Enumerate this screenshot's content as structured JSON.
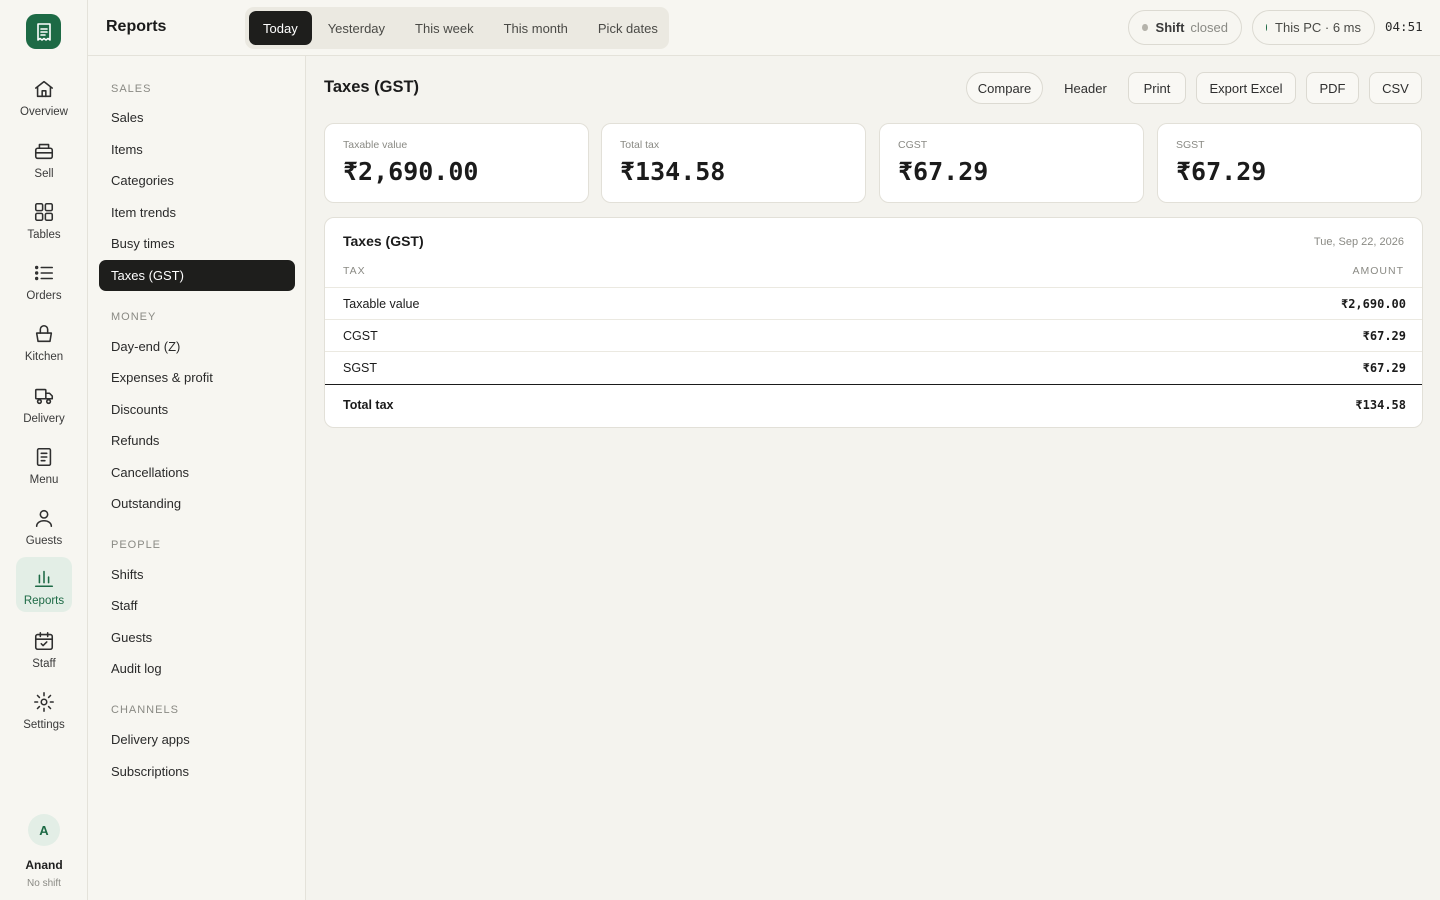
{
  "rail": {
    "items": [
      {
        "label": "Overview",
        "icon": "home-icon"
      },
      {
        "label": "Sell",
        "icon": "register-icon"
      },
      {
        "label": "Tables",
        "icon": "grid-icon"
      },
      {
        "label": "Orders",
        "icon": "list-icon"
      },
      {
        "label": "Kitchen",
        "icon": "basket-icon"
      },
      {
        "label": "Delivery",
        "icon": "truck-icon"
      },
      {
        "label": "Menu",
        "icon": "menu-book-icon"
      },
      {
        "label": "Guests",
        "icon": "person-icon"
      },
      {
        "label": "Reports",
        "icon": "bar-chart-icon",
        "active": true
      },
      {
        "label": "Staff",
        "icon": "calendar-icon"
      },
      {
        "label": "Settings",
        "icon": "sun-gear-icon"
      }
    ],
    "user": {
      "initial": "A",
      "name": "Anand",
      "status": "No shift"
    }
  },
  "topbar": {
    "title": "Reports",
    "ranges": [
      "Today",
      "Yesterday",
      "This week",
      "This month",
      "Pick dates"
    ],
    "active_range": "Today",
    "shift_label": "Shift",
    "shift_status": "closed",
    "device": "This PC · 6 ms",
    "clock": "04:51"
  },
  "colors": {
    "accent": "#1d6a45",
    "active_dark": "#1e1e1c",
    "status_closed": "#b5b3ab",
    "status_online": "#1d6a45"
  },
  "subnav": {
    "sections": [
      {
        "title": "SALES",
        "items": [
          "Sales",
          "Items",
          "Categories",
          "Item trends",
          "Busy times",
          "Taxes (GST)"
        ]
      },
      {
        "title": "MONEY",
        "items": [
          "Day-end (Z)",
          "Expenses & profit",
          "Discounts",
          "Refunds",
          "Cancellations",
          "Outstanding"
        ]
      },
      {
        "title": "PEOPLE",
        "items": [
          "Shifts",
          "Staff",
          "Guests",
          "Audit log"
        ]
      },
      {
        "title": "CHANNELS",
        "items": [
          "Delivery apps",
          "Subscriptions"
        ]
      }
    ],
    "active": "Taxes (GST)"
  },
  "main": {
    "title": "Taxes (GST)",
    "actions": {
      "compare": "Compare",
      "header": "Header",
      "print": "Print",
      "excel": "Export Excel",
      "pdf": "PDF",
      "csv": "CSV"
    },
    "cards": [
      {
        "label": "Taxable value",
        "value": "₹2,690.00"
      },
      {
        "label": "Total tax",
        "value": "₹134.58"
      },
      {
        "label": "CGST",
        "value": "₹67.29"
      },
      {
        "label": "SGST",
        "value": "₹67.29"
      }
    ],
    "table": {
      "title": "Taxes (GST)",
      "date": "Tue, Sep 22, 2026",
      "col_tax": "TAX",
      "col_amount": "AMOUNT",
      "rows": [
        {
          "tax": "Taxable value",
          "amount": "₹2,690.00"
        },
        {
          "tax": "CGST",
          "amount": "₹67.29"
        },
        {
          "tax": "SGST",
          "amount": "₹67.29"
        }
      ],
      "total": {
        "tax": "Total tax",
        "amount": "₹134.58"
      }
    }
  }
}
